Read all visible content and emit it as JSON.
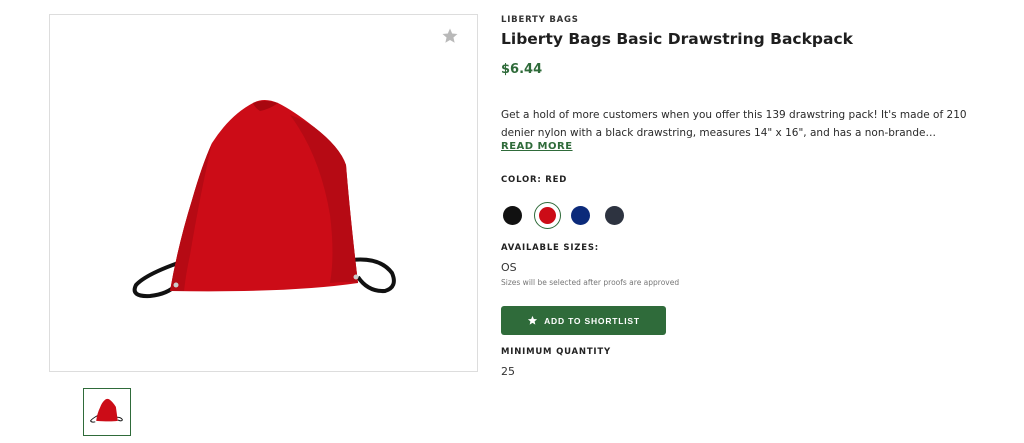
{
  "product": {
    "brand": "LIBERTY BAGS",
    "title": "Liberty Bags Basic Drawstring Backpack",
    "price": "$6.44",
    "description": "Get a hold of more customers when you offer this 139 drawstring pack! It's made of 210 denier nylon with a black drawstring, measures 14\" x 16\", and has a non-brande…",
    "read_more_label": "READ MORE",
    "image_icon": "drawstring-backpack-red"
  },
  "color": {
    "label": "COLOR: RED",
    "swatches": [
      {
        "name": "black",
        "hex": "#111111"
      },
      {
        "name": "red",
        "hex": "#cc0c17",
        "selected": true
      },
      {
        "name": "navy",
        "hex": "#0b2a7a"
      },
      {
        "name": "charcoal",
        "hex": "#2d3340"
      }
    ]
  },
  "sizes": {
    "label": "AVAILABLE SIZES:",
    "value": "OS",
    "note": "Sizes will be selected after proofs are approved"
  },
  "shortlist": {
    "label": "ADD TO SHORTLIST",
    "icon": "star-icon"
  },
  "minimum": {
    "label": "MINIMUM QUANTITY",
    "value": "25"
  },
  "colors": {
    "accent": "#2f6b3a",
    "border": "#dddddd"
  }
}
